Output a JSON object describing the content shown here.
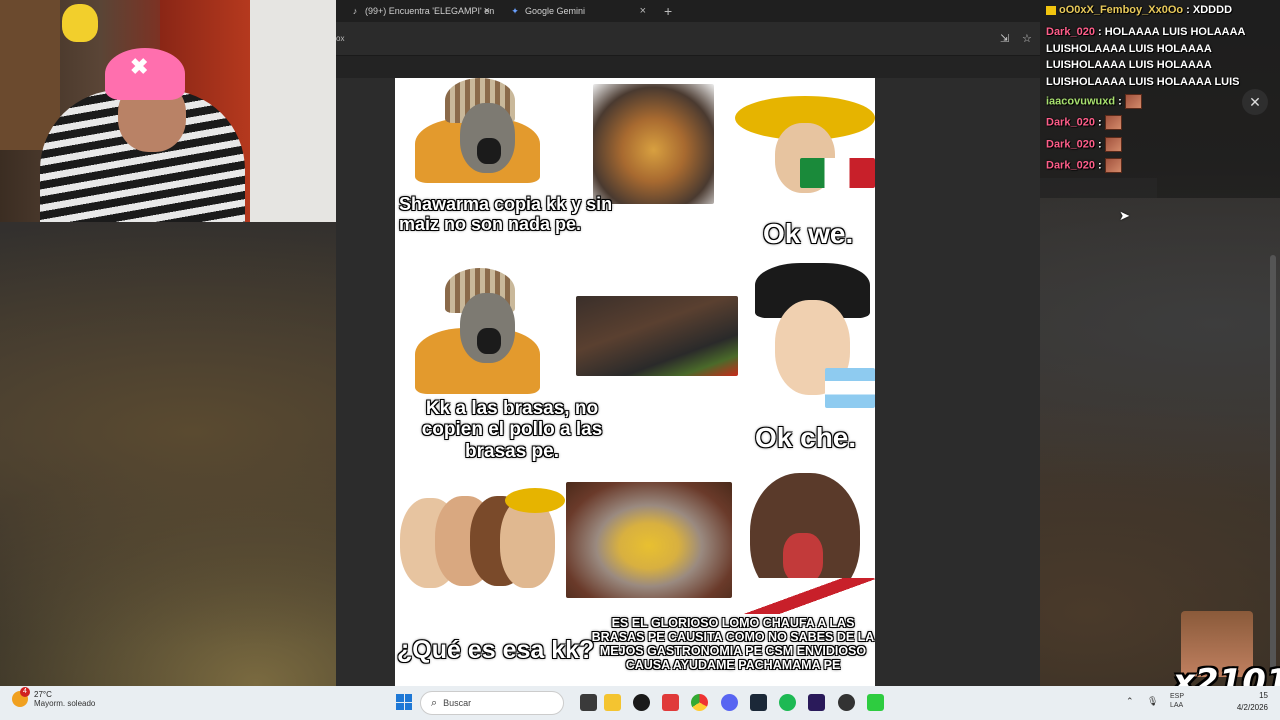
{
  "browser": {
    "tabs": [
      {
        "label": "(99+) Encuentra 'ELEGAMPI' en",
        "icon": "tiktok-icon"
      },
      {
        "label": "Google Gemini",
        "icon": "gemini-icon"
      }
    ],
    "address_fragment": "ox"
  },
  "meme": {
    "panel1_text": "Shawarma copia kk y sin maiz no son nada pe.",
    "panel1_reply": "Ok we.",
    "panel2_text": "Kk a las brasas, no copien el pollo a las brasas pe.",
    "panel2_reply": "Ok che.",
    "panel3_text": "¿Qué es esa kk?",
    "panel3_reply": "ES EL GLORIOSO LOMO CHAUFA A LAS BRASAS PE CAUSITA COMO NO SABES DE LA MEJOS GASTRONOMIA PE CSM ENVIDIOSO CAUSA AYUDAME PACHAMAMA PE"
  },
  "chat": {
    "messages": [
      {
        "user": "oO0xX_Femboy_Xx0Oo",
        "text": "XDDDD"
      },
      {
        "user": "Dark_020",
        "text": "HOLAAAA LUIS HOLAAAA LUISHOLAAAA LUIS HOLAAAA LUISHOLAAAA LUIS HOLAAAA LUISHOLAAAA LUIS HOLAAAA LUIS"
      },
      {
        "user": "iaacovuwuxd",
        "text": ""
      },
      {
        "user": "Dark_020",
        "text": ""
      },
      {
        "user": "Dark_020",
        "text": ""
      },
      {
        "user": "Dark_020",
        "text": ""
      }
    ],
    "sep": ":"
  },
  "overlay": {
    "counter_text": "x2101"
  },
  "taskbar": {
    "weather_badge": "4",
    "temperature": "27°C",
    "weather_desc": "Mayorm. soleado",
    "search_placeholder": "Buscar",
    "lang_1": "ESP",
    "lang_2": "LAA",
    "time": "15",
    "date": "4/2/2026"
  }
}
